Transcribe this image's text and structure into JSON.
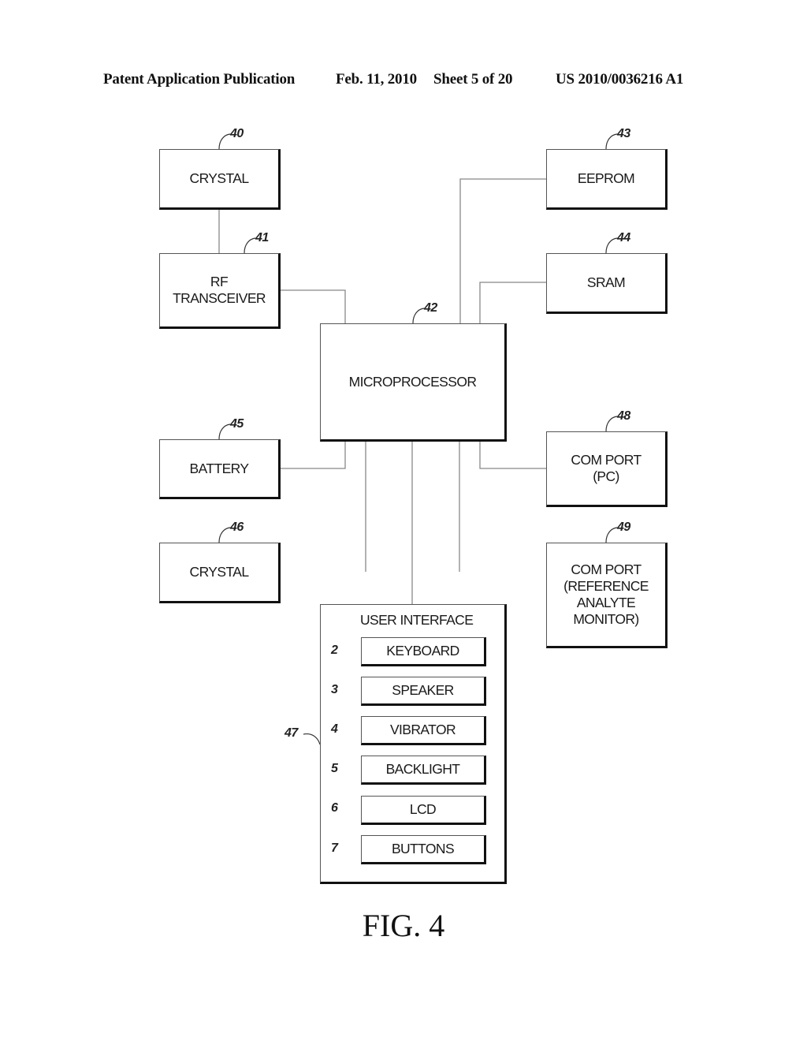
{
  "header": {
    "publication": "Patent Application Publication",
    "date": "Feb. 11, 2010",
    "sheet": "Sheet 5 of 20",
    "number": "US 2010/0036216 A1"
  },
  "blocks": {
    "crystal_top": {
      "label": "CRYSTAL",
      "ref": "40"
    },
    "rf_transceiver": {
      "label": "RF\nTRANSCEIVER",
      "ref": "41"
    },
    "microprocessor": {
      "label": "MICROPROCESSOR",
      "ref": "42"
    },
    "eeprom": {
      "label": "EEPROM",
      "ref": "43"
    },
    "sram": {
      "label": "SRAM",
      "ref": "44"
    },
    "battery": {
      "label": "BATTERY",
      "ref": "45"
    },
    "crystal_bottom": {
      "label": "CRYSTAL",
      "ref": "46"
    },
    "com_port_pc": {
      "label": "COM PORT\n(PC)",
      "ref": "48"
    },
    "com_port_ref": {
      "label": "COM PORT\n(REFERENCE\nANALYTE\nMONITOR)",
      "ref": "49"
    }
  },
  "user_interface": {
    "title": "USER INTERFACE",
    "ref": "47",
    "items": [
      {
        "label": "KEYBOARD",
        "ref": "2"
      },
      {
        "label": "SPEAKER",
        "ref": "3"
      },
      {
        "label": "VIBRATOR",
        "ref": "4"
      },
      {
        "label": "BACKLIGHT",
        "ref": "5"
      },
      {
        "label": "LCD",
        "ref": "6"
      },
      {
        "label": "BUTTONS",
        "ref": "7"
      }
    ]
  },
  "caption": "FIG. 4"
}
